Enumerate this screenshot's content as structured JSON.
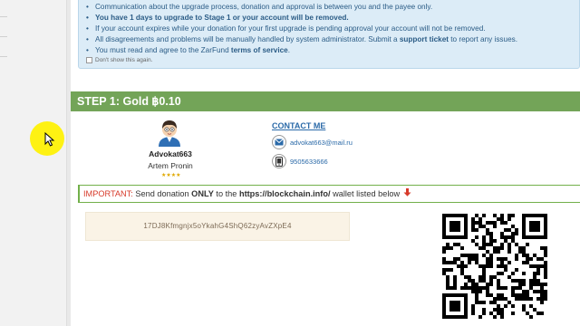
{
  "notice": {
    "items": [
      {
        "text": "Communication about the upgrade process, donation and approval is between you and the payee only.",
        "strong": false
      },
      {
        "text": "You have 1 days to upgrade to Stage 1 or your account will be removed.",
        "strong": true
      },
      {
        "text": "If your account expires while your donation for your first upgrade is pending approval your account will not be removed.",
        "strong": false
      }
    ],
    "item4_prefix": "All disagreements and problems will be manually handled by system administrator. Submit a ",
    "item4_link": "support ticket",
    "item4_suffix": " to report any issues.",
    "item5_prefix": "You must read and agree to the ZarFund ",
    "item5_link": "terms of service",
    "item5_suffix": ".",
    "dont_show": "Don't show this again."
  },
  "step": {
    "title": "STEP 1: Gold ฿0.10"
  },
  "payee": {
    "username": "Advokat663",
    "full_name": "Artem Pronin",
    "rating_stars": "★★★★",
    "rating": 4
  },
  "contact": {
    "title": "CONTACT ME",
    "email": "advokat663@mail.ru",
    "phone": "9505633666"
  },
  "important": {
    "label": "IMPORTANT:",
    "pre": " Send donation ",
    "only": "ONLY",
    "mid": " to the ",
    "site": "https://blockchain.info/",
    "post": " wallet listed below"
  },
  "wallet": {
    "address": "17DJ8Kfmgnjx5oYkahG4ShQ62zyAvZXpE4"
  },
  "colors": {
    "step_bar": "#73a458",
    "notice_bg": "#dcecf7",
    "notice_text": "#2b5c86",
    "important_red": "#d73a2a",
    "link_blue": "#2b6aa8",
    "wallet_bg": "#faf3e6"
  }
}
